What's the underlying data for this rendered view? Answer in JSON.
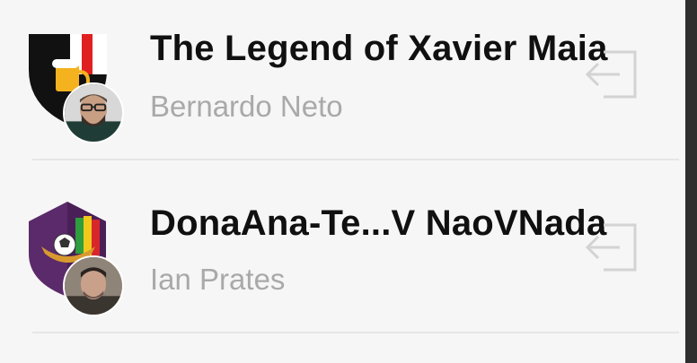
{
  "colors": {
    "background": "#f6f6f6",
    "team_name": "#101010",
    "owner_name": "#a9a9a9",
    "divider": "#e6e6e6",
    "exit_icon": "#d3d3d3"
  },
  "teams": [
    {
      "name": "The Legend of Xavier Maia",
      "owner": "Bernardo Neto",
      "crest_icon": "black-shield-beer-crest-icon",
      "avatar_icon": "user-avatar-icon",
      "action_icon": "exit-icon"
    },
    {
      "name": "DonaAna-Te...V NaoVNada",
      "owner": "Ian Prates",
      "crest_icon": "purple-shield-ball-crest-icon",
      "avatar_icon": "user-avatar-icon",
      "action_icon": "exit-icon"
    }
  ]
}
